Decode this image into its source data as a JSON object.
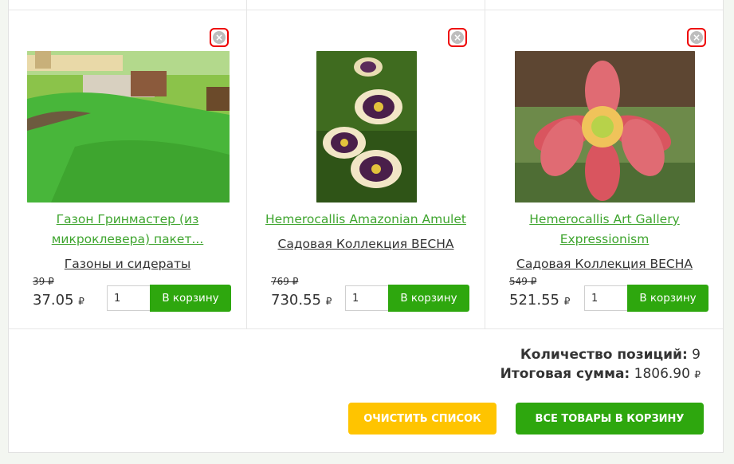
{
  "products": [
    {
      "title": "Газон Гринмастер (из микроклевера) пакет...",
      "category": "Газоны и сидераты",
      "old_price": "39 ₽",
      "price": "37.05",
      "currency": "₽",
      "quantity": "1",
      "add_to_cart_label": "В корзину",
      "remove_icon": "close-icon",
      "image_desc": "lawn-photo"
    },
    {
      "title": "Hemerocallis Amazonian Amulet",
      "category": "Садовая Коллекция ВЕСНА",
      "old_price": "769 ₽",
      "price": "730.55",
      "currency": "₽",
      "quantity": "1",
      "add_to_cart_label": "В корзину",
      "remove_icon": "close-icon",
      "image_desc": "daylily-photo"
    },
    {
      "title": "Hemerocallis Art Gallery Expressionism",
      "category": "Садовая Коллекция ВЕСНА",
      "old_price": "549 ₽",
      "price": "521.55",
      "currency": "₽",
      "quantity": "1",
      "add_to_cart_label": "В корзину",
      "remove_icon": "close-icon",
      "image_desc": "daylily-photo"
    }
  ],
  "summary": {
    "positions_label": "Количество позиций:",
    "positions_value": "9",
    "total_label": "Итоговая сумма:",
    "total_value": "1806.90",
    "currency": "₽"
  },
  "actions": {
    "clear_label": "ОЧИСТИТЬ СПИСОК",
    "all_to_cart_label": "ВСЕ ТОВАРЫ В КОРЗИНУ"
  },
  "colors": {
    "accent_green": "#2ea70e",
    "link_green": "#3fa52f",
    "clear_yellow": "#ffc400",
    "remove_red": "#e00000"
  }
}
